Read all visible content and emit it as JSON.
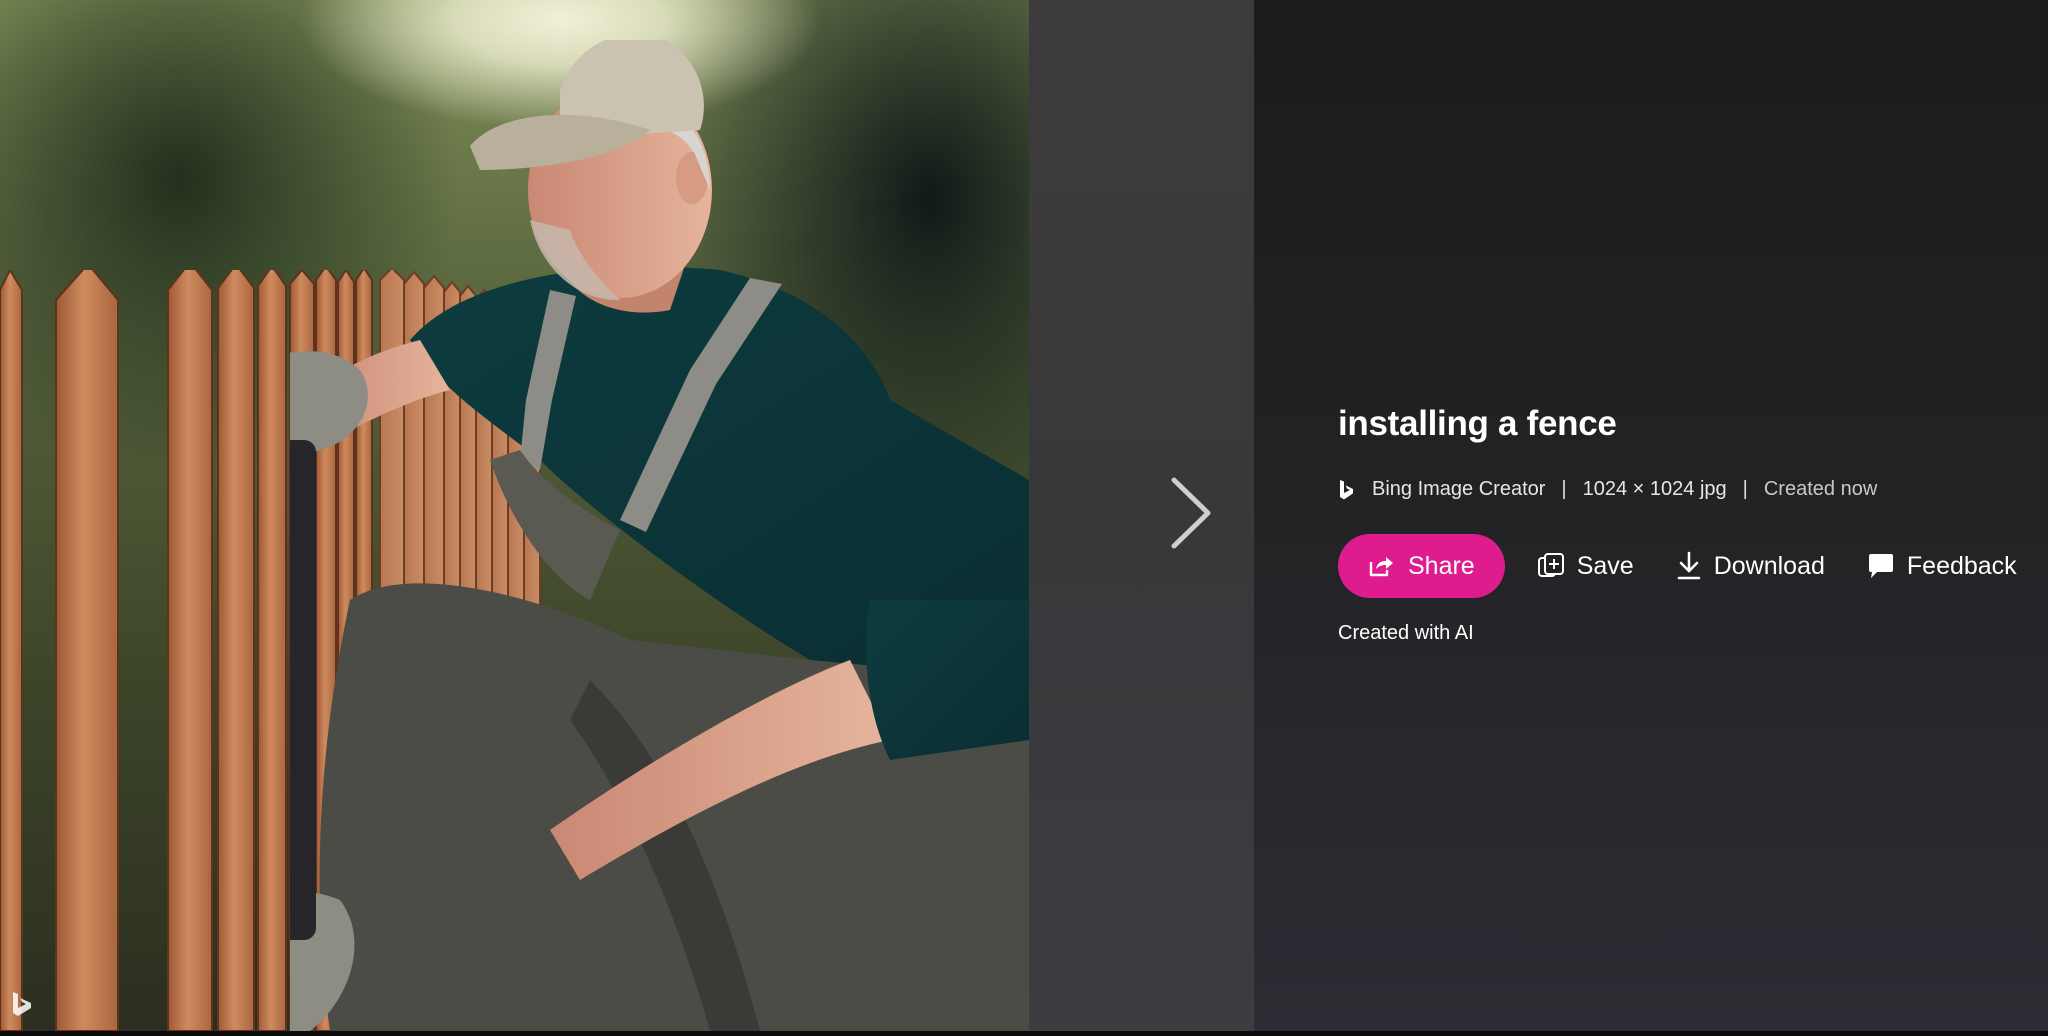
{
  "image": {
    "alt": "installing a fence",
    "watermark_icon": "bing-b-icon"
  },
  "navigation": {
    "next_icon": "chevron-right-icon"
  },
  "details": {
    "title": "installing a fence",
    "source": "Bing Image Creator",
    "separator": "|",
    "dimensions": "1024 × 1024 jpg",
    "created": "Created now",
    "ai_note": "Created with AI"
  },
  "actions": {
    "share_label": "Share",
    "save_label": "Save",
    "download_label": "Download",
    "feedback_label": "Feedback"
  },
  "colors": {
    "accent": "#de1c8e",
    "panel": "#222224"
  }
}
